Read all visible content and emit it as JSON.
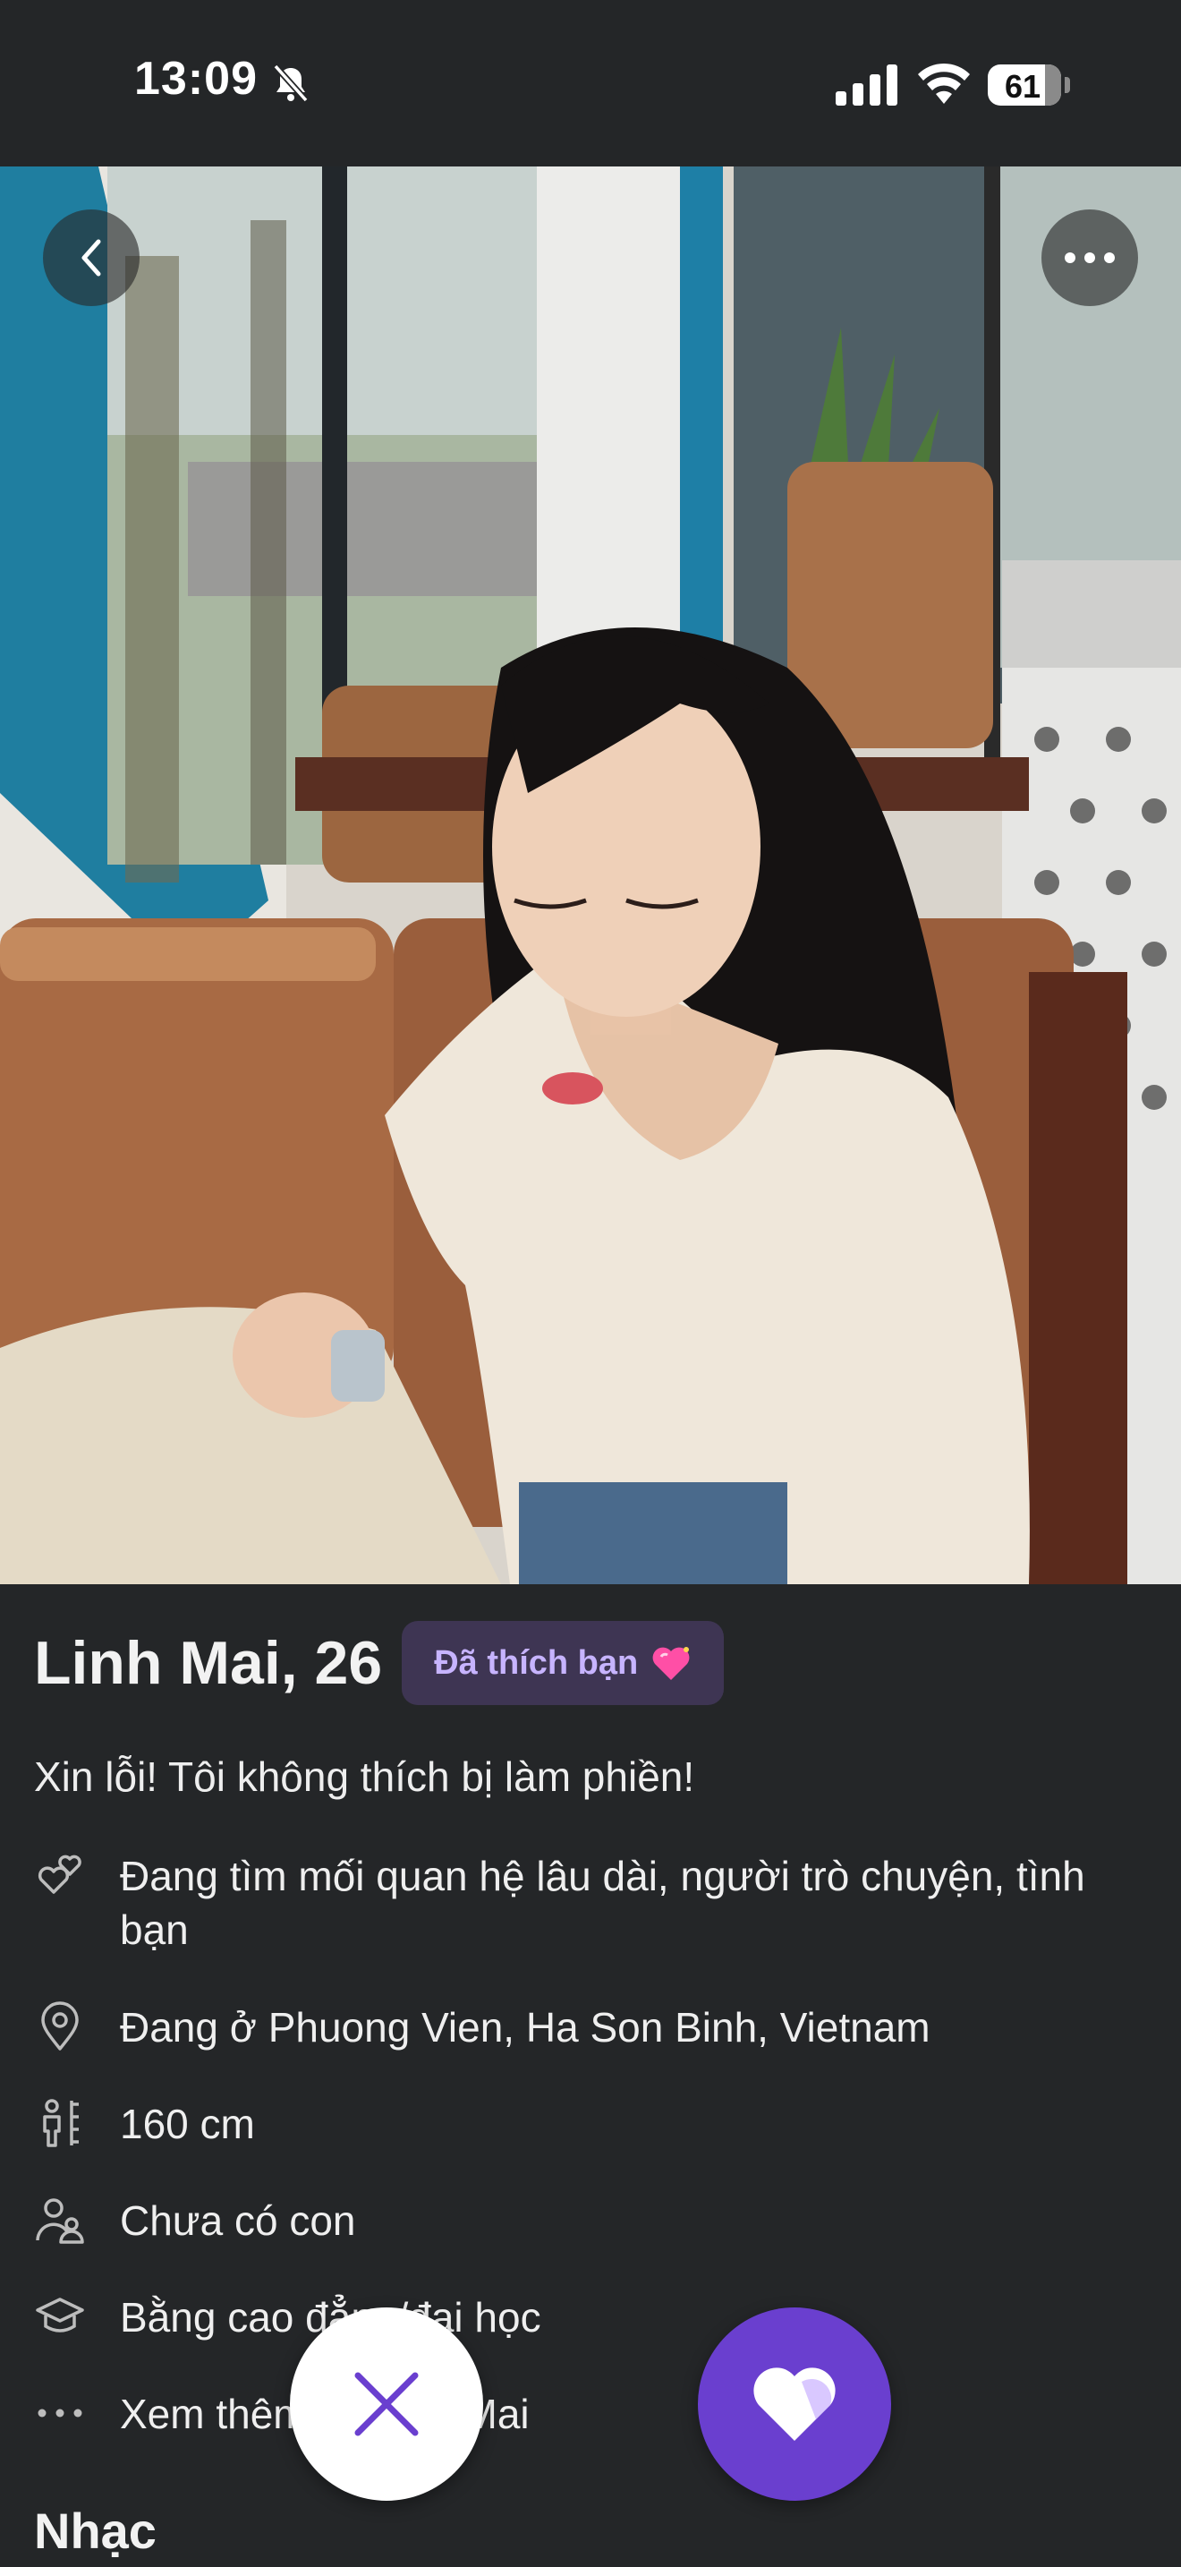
{
  "status_bar": {
    "time": "13:09",
    "battery": "61"
  },
  "profile": {
    "name": "Linh Mai, 26",
    "liked_badge": "Đã thích bạn",
    "bio": "Xin lỗi! Tôi không thích bị làm phiền!",
    "details": [
      {
        "icon": "hearts-icon",
        "text": "Đang tìm mối quan hệ lâu dài, người trò chuyện, tình bạn"
      },
      {
        "icon": "location-pin-icon",
        "text": "Đang ở Phuong Vien, Ha Son Binh, Vietnam"
      },
      {
        "icon": "height-icon",
        "text": "160 cm"
      },
      {
        "icon": "children-icon",
        "text": "Chưa có con"
      },
      {
        "icon": "graduation-cap-icon",
        "text": "Bằng cao đẳng/đại học"
      },
      {
        "icon": "more-dots-icon",
        "text": "Xem thêm về Linh Mai"
      }
    ],
    "section_title": "Nhạc"
  },
  "colors": {
    "background": "#242628",
    "accent": "#6a3fcf",
    "badge_bg": "#3e3553",
    "badge_text": "#c7b4ff"
  }
}
